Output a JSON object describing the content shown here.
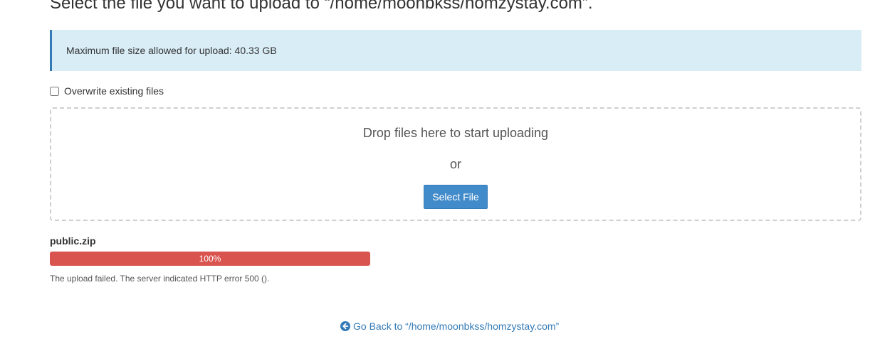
{
  "header": {
    "title": "Select the file you want to upload to “/home/moonbkss/homzystay.com”."
  },
  "alert": {
    "text": "Maximum file size allowed for upload: 40.33 GB"
  },
  "overwrite": {
    "label": "Overwrite existing files",
    "checked": false
  },
  "dropzone": {
    "drop_text": "Drop files here to start uploading",
    "or_text": "or",
    "select_button_label": "Select File"
  },
  "upload": {
    "file_name": "public.zip",
    "progress_label": "100%",
    "progress_fraction": 1.0,
    "status_color": "#d9534f",
    "error_message": "The upload failed. The server indicated HTTP error 500 ()."
  },
  "footer": {
    "back_link_icon": "arrow-circle-left-icon",
    "back_link_label": "Go Back to “/home/moonbkss/homzystay.com”"
  }
}
